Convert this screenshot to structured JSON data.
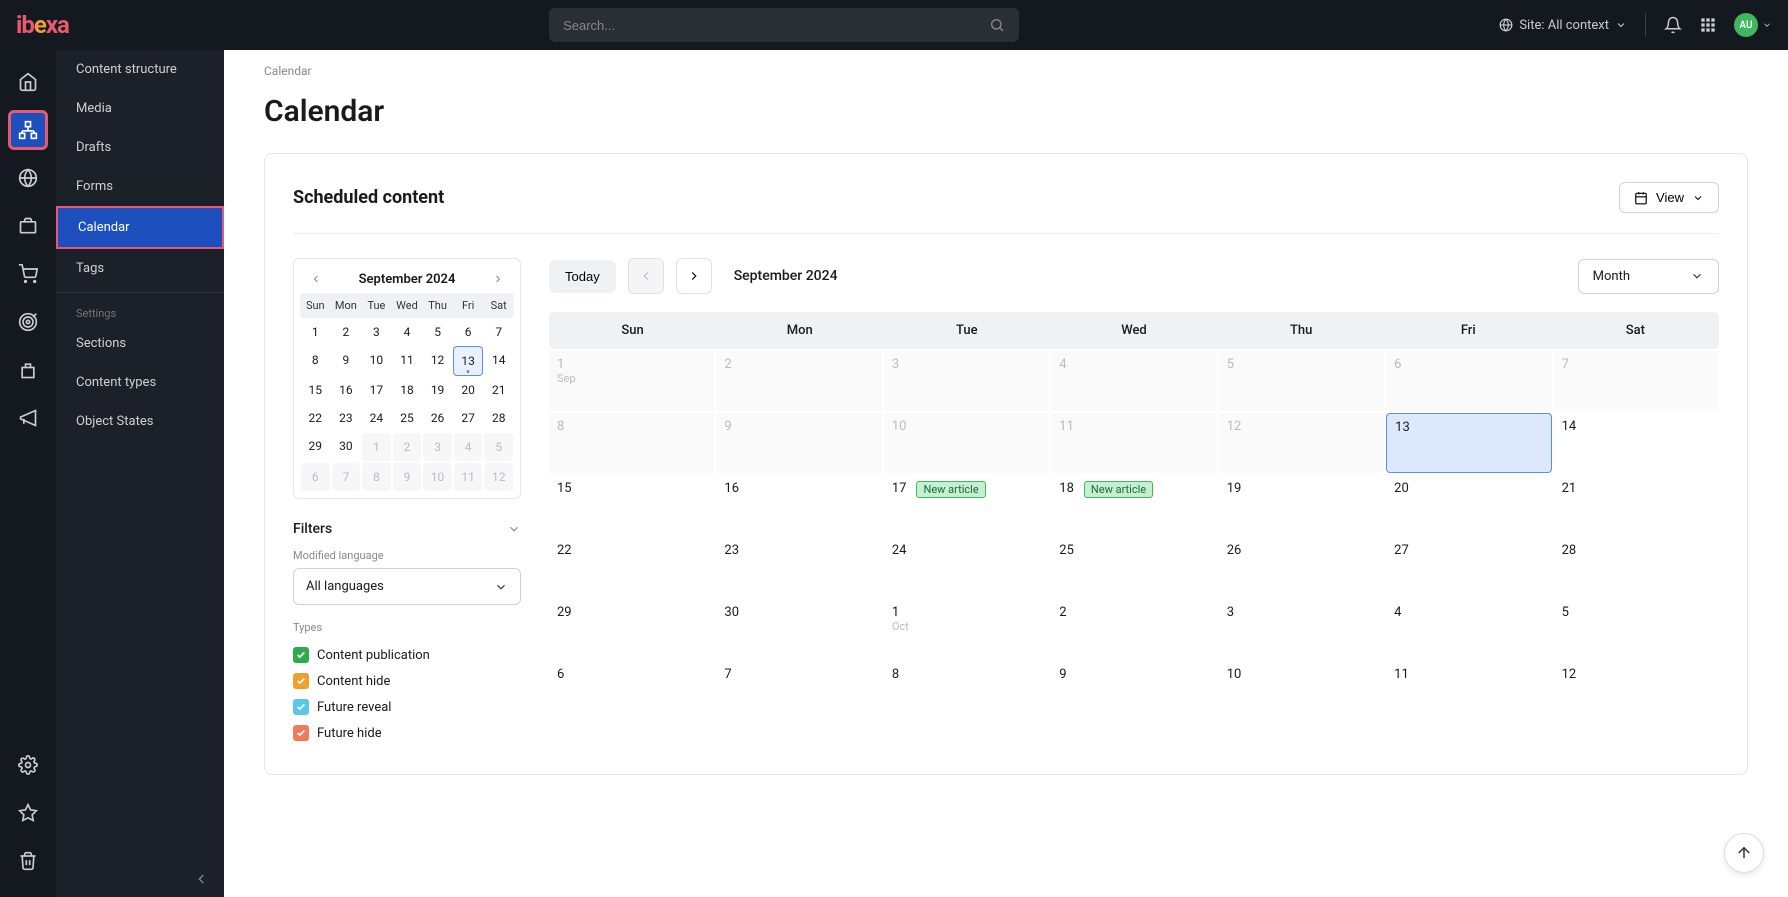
{
  "topbar": {
    "search_placeholder": "Search...",
    "site_context": "Site: All context",
    "avatar": "AU"
  },
  "submenu": {
    "items": [
      "Content structure",
      "Media",
      "Drafts",
      "Forms",
      "Calendar",
      "Tags"
    ],
    "settings_heading": "Settings",
    "settings_items": [
      "Sections",
      "Content types",
      "Object States"
    ]
  },
  "breadcrumb": "Calendar",
  "page_title": "Calendar",
  "panel": {
    "title": "Scheduled content",
    "view_label": "View"
  },
  "minical": {
    "title": "September 2024",
    "dow": [
      "Sun",
      "Mon",
      "Tue",
      "Wed",
      "Thu",
      "Fri",
      "Sat"
    ],
    "rows": [
      [
        {
          "n": "1"
        },
        {
          "n": "2"
        },
        {
          "n": "3"
        },
        {
          "n": "4"
        },
        {
          "n": "5"
        },
        {
          "n": "6"
        },
        {
          "n": "7"
        }
      ],
      [
        {
          "n": "8"
        },
        {
          "n": "9"
        },
        {
          "n": "10"
        },
        {
          "n": "11"
        },
        {
          "n": "12"
        },
        {
          "n": "13",
          "today": true
        },
        {
          "n": "14"
        }
      ],
      [
        {
          "n": "15"
        },
        {
          "n": "16"
        },
        {
          "n": "17"
        },
        {
          "n": "18"
        },
        {
          "n": "19"
        },
        {
          "n": "20"
        },
        {
          "n": "21"
        }
      ],
      [
        {
          "n": "22"
        },
        {
          "n": "23"
        },
        {
          "n": "24"
        },
        {
          "n": "25"
        },
        {
          "n": "26"
        },
        {
          "n": "27"
        },
        {
          "n": "28"
        }
      ],
      [
        {
          "n": "29"
        },
        {
          "n": "30"
        },
        {
          "n": "1",
          "other": true
        },
        {
          "n": "2",
          "other": true
        },
        {
          "n": "3",
          "other": true
        },
        {
          "n": "4",
          "other": true
        },
        {
          "n": "5",
          "other": true
        }
      ],
      [
        {
          "n": "6",
          "other": true
        },
        {
          "n": "7",
          "other": true
        },
        {
          "n": "8",
          "other": true
        },
        {
          "n": "9",
          "other": true
        },
        {
          "n": "10",
          "other": true
        },
        {
          "n": "11",
          "other": true
        },
        {
          "n": "12",
          "other": true
        }
      ]
    ]
  },
  "filters": {
    "title": "Filters",
    "modified_language_label": "Modified language",
    "language_value": "All languages",
    "types_label": "Types",
    "types": [
      {
        "label": "Content publication",
        "color": "#2eab4f"
      },
      {
        "label": "Content hide",
        "color": "#f0a030"
      },
      {
        "label": "Future reveal",
        "color": "#5cc6e8"
      },
      {
        "label": "Future hide",
        "color": "#f07a5c"
      }
    ]
  },
  "bigcal": {
    "today_label": "Today",
    "month_label": "September  2024",
    "period": "Month",
    "dow": [
      "Sun",
      "Mon",
      "Tue",
      "Wed",
      "Thu",
      "Fri",
      "Sat"
    ],
    "weeks": [
      [
        {
          "n": "1",
          "sub": "Sep",
          "past": true
        },
        {
          "n": "2",
          "past": true
        },
        {
          "n": "3",
          "past": true
        },
        {
          "n": "4",
          "past": true
        },
        {
          "n": "5",
          "past": true
        },
        {
          "n": "6",
          "past": true
        },
        {
          "n": "7",
          "past": true
        }
      ],
      [
        {
          "n": "8",
          "past": true
        },
        {
          "n": "9",
          "past": true
        },
        {
          "n": "10",
          "past": true
        },
        {
          "n": "11",
          "past": true
        },
        {
          "n": "12",
          "past": true
        },
        {
          "n": "13",
          "today": true
        },
        {
          "n": "14"
        }
      ],
      [
        {
          "n": "15"
        },
        {
          "n": "16"
        },
        {
          "n": "17",
          "event": "New article"
        },
        {
          "n": "18",
          "event": "New article"
        },
        {
          "n": "19"
        },
        {
          "n": "20"
        },
        {
          "n": "21"
        }
      ],
      [
        {
          "n": "22"
        },
        {
          "n": "23"
        },
        {
          "n": "24"
        },
        {
          "n": "25"
        },
        {
          "n": "26"
        },
        {
          "n": "27"
        },
        {
          "n": "28"
        }
      ],
      [
        {
          "n": "29"
        },
        {
          "n": "30"
        },
        {
          "n": "1",
          "sub": "Oct"
        },
        {
          "n": "2"
        },
        {
          "n": "3"
        },
        {
          "n": "4"
        },
        {
          "n": "5"
        }
      ],
      [
        {
          "n": "6"
        },
        {
          "n": "7"
        },
        {
          "n": "8"
        },
        {
          "n": "9"
        },
        {
          "n": "10"
        },
        {
          "n": "11"
        },
        {
          "n": "12"
        }
      ]
    ]
  }
}
